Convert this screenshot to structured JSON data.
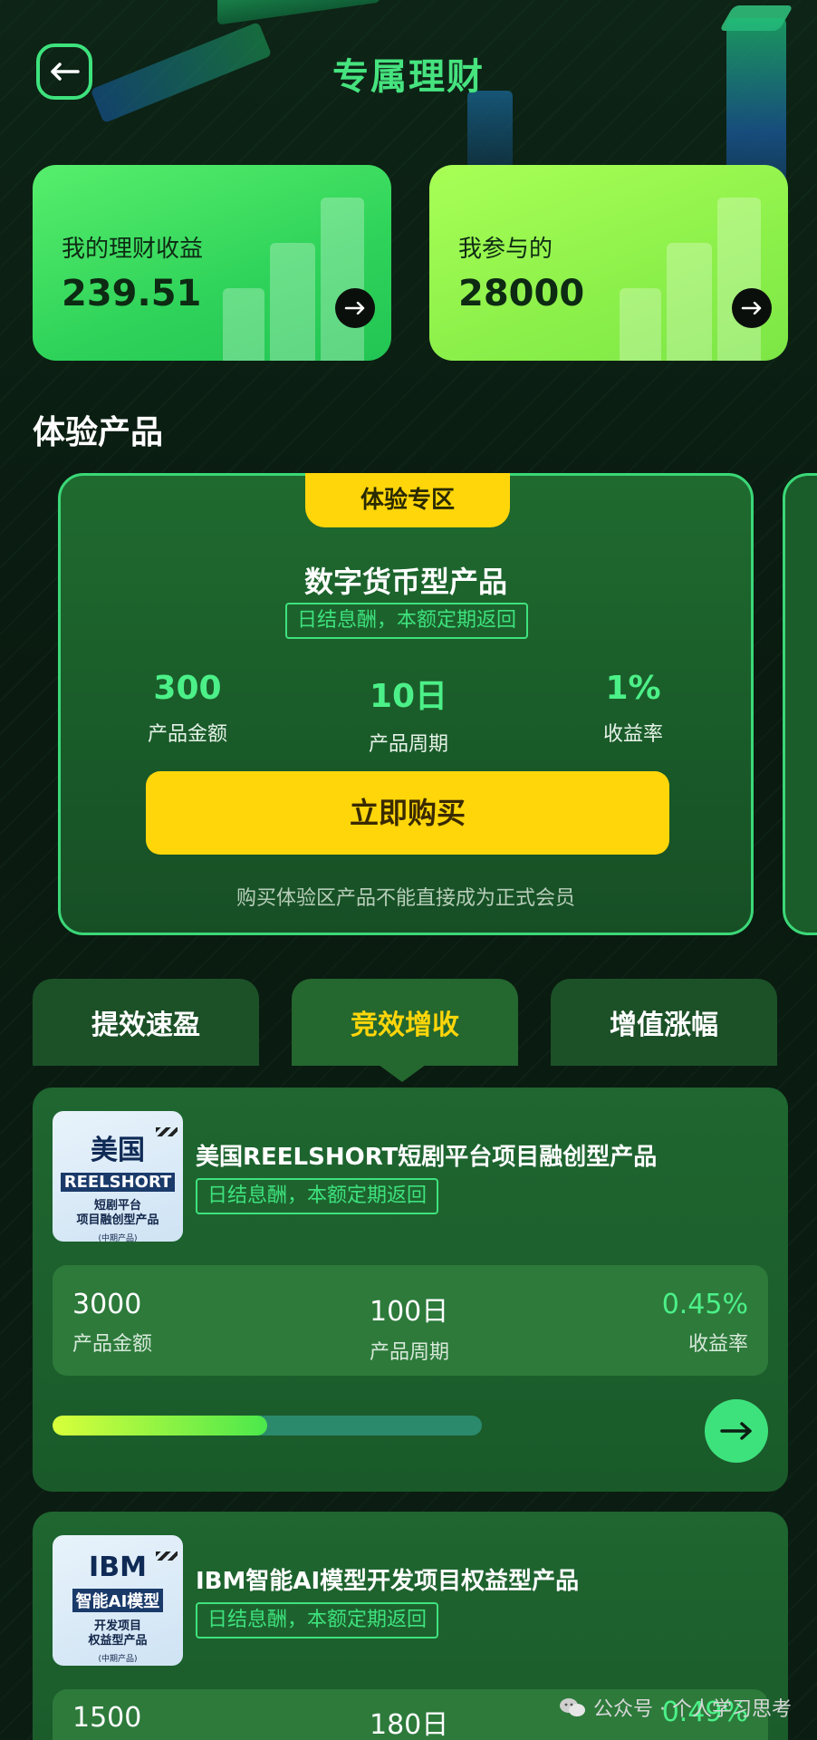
{
  "header": {
    "title": "专属理财",
    "back_icon": "arrow-left-icon"
  },
  "summary": [
    {
      "label": "我的理财收益",
      "value": "239.51",
      "color": "#2fd35a"
    },
    {
      "label": "我参与的",
      "value": "28000",
      "color": "#8cf04a"
    }
  ],
  "section_title": "体验产品",
  "experience": {
    "tag": "体验专区",
    "title": "数字货币型产品",
    "badge": "日结息酬，本额定期返回",
    "stats": [
      {
        "value": "300",
        "label": "产品金额"
      },
      {
        "value": "10日",
        "label": "产品周期"
      },
      {
        "value": "1%",
        "label": "收益率"
      }
    ],
    "buy_label": "立即购买",
    "note": "购买体验区产品不能直接成为正式会员"
  },
  "tabs": [
    {
      "label": "提效速盈",
      "active": false
    },
    {
      "label": "竞效增收",
      "active": true
    },
    {
      "label": "增值涨幅",
      "active": false
    }
  ],
  "products": [
    {
      "name": "美国REELSHORT短剧平台项目融创型产品",
      "badge": "日结息酬，本额定期返回",
      "thumb": {
        "big": "美国",
        "mid": "REELSHORT",
        "sm1": "短剧平台",
        "sm2": "项目融创型产品",
        "xs": "(中期产品)"
      },
      "amount": "3000",
      "amount_label": "产品金额",
      "period": "100日",
      "period_label": "产品周期",
      "rate": "0.45%",
      "rate_label": "收益率",
      "progress": 0.5
    },
    {
      "name": "IBM智能AI模型开发项目权益型产品",
      "badge": "日结息酬，本额定期返回",
      "thumb": {
        "big": "IBM",
        "mid": "智能AI模型",
        "sm1": "开发项目",
        "sm2": "权益型产品",
        "xs": "(中期产品)"
      },
      "amount": "1500",
      "period": "180日",
      "rate": "0.49%"
    }
  ],
  "watermark": "公众号 · 个人学习思考"
}
